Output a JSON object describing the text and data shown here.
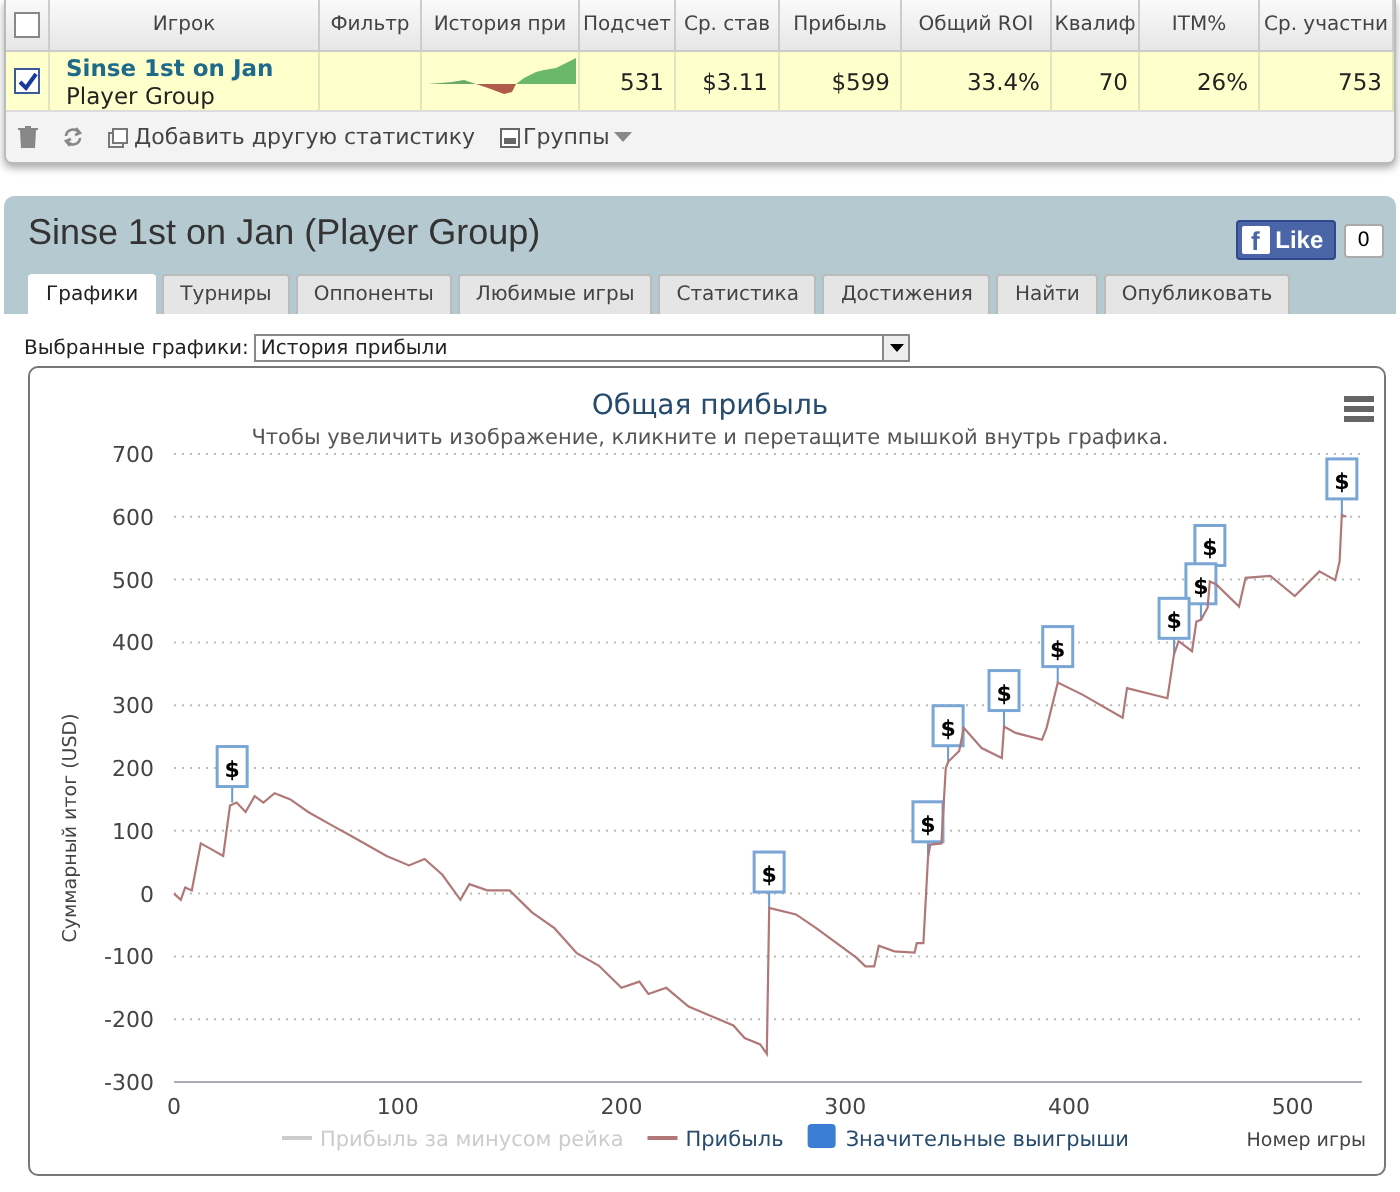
{
  "table": {
    "header_checked": false,
    "columns": [
      "Игрок",
      "Фильтр",
      "История при",
      "Подсчет",
      "Ср. став",
      "Прибыль",
      "Общий ROI",
      "Квалиф",
      "ITM%",
      "Ср. участни"
    ],
    "rows": [
      {
        "checked": true,
        "cells": [
          {
            "kind": "player",
            "name": "Sinse 1st on Jan",
            "type": "Player Group"
          },
          {
            "kind": "empty"
          },
          {
            "kind": "sparkline"
          },
          {
            "kind": "text",
            "text": "531"
          },
          {
            "kind": "text",
            "text": "$3.11"
          },
          {
            "kind": "text",
            "text": "$599"
          },
          {
            "kind": "text",
            "text": "33.4%"
          },
          {
            "kind": "text",
            "text": "70"
          },
          {
            "kind": "text",
            "text": "26%"
          },
          {
            "kind": "text",
            "text": "753"
          }
        ]
      }
    ],
    "toolbar": [
      {
        "kind": "delete"
      },
      {
        "kind": "refresh"
      },
      {
        "kind": "add",
        "label": "Добавить другую статистику"
      },
      {
        "kind": "groups",
        "label": "Группы"
      }
    ]
  },
  "group": {
    "title": "Sinse 1st on Jan (Player Group)",
    "like": {
      "icon": "f",
      "label": "Like",
      "count": "0"
    },
    "tabs": [
      {
        "label": "Графики",
        "selected": true
      },
      {
        "label": "Турниры",
        "selected": false
      },
      {
        "label": "Оппоненты",
        "selected": false
      },
      {
        "label": "Любимые игры",
        "selected": false
      },
      {
        "label": "Статистика",
        "selected": false
      },
      {
        "label": "Достижения",
        "selected": false
      },
      {
        "label": "Найти",
        "selected": false
      },
      {
        "label": "Опубликовать",
        "selected": false
      }
    ],
    "selector": {
      "label": "Выбранные графики:",
      "value": "История прибыли"
    },
    "chart": {
      "subtitle": "Чтобы увеличить изображение, кликните и перетащите мышкой внутрь графика.",
      "legend": [
        {
          "label": "Прибыль за минусом рейка",
          "kind": "line",
          "enabled": false,
          "color": "#cccccc"
        },
        {
          "kind": "series",
          "enabled": true
        },
        {
          "label": "Значительные выигрыши",
          "kind": "flag",
          "enabled": true,
          "color": "#3a7fd5"
        }
      ],
      "chart_data": {
        "type": "line",
        "title": "Общая прибыль",
        "xlabel": "Номер игры",
        "ylabel": "Суммарный итог (USD)",
        "grid": true,
        "x": [
          0,
          3,
          5,
          8,
          12,
          17,
          22,
          25,
          28,
          32,
          36,
          40,
          45,
          52,
          60,
          70,
          80,
          95,
          105,
          112,
          120,
          128,
          132,
          140,
          150,
          160,
          170,
          180,
          190,
          200,
          208,
          212,
          220,
          230,
          240,
          250,
          255,
          262,
          265,
          266,
          278,
          287,
          305,
          309,
          313,
          315,
          322,
          331,
          332,
          335,
          337,
          338,
          343,
          345,
          346,
          351,
          353,
          361,
          370,
          371,
          376,
          388,
          390,
          395,
          406,
          424,
          426,
          444,
          447,
          449,
          455,
          457,
          459,
          462,
          463,
          466,
          476,
          479,
          490,
          501,
          512,
          519,
          521,
          522,
          524
        ],
        "series": [
          {
            "name": "Прибыль",
            "color": "#b07878",
            "values": [
              0,
              -10,
              10,
              5,
              80,
              70,
              60,
              140,
              145,
              130,
              155,
              145,
              160,
              150,
              130,
              110,
              90,
              60,
              45,
              55,
              30,
              -10,
              15,
              5,
              5,
              -30,
              -55,
              -95,
              -115,
              -150,
              -140,
              -160,
              -150,
              -180,
              -195,
              -210,
              -230,
              -240,
              -255,
              -23,
              -33,
              -55,
              -102,
              -116,
              -116,
              -83,
              -92,
              -94,
              -79,
              -79,
              57,
              78,
              80,
              200,
              210,
              227,
              264,
              232,
              216,
              266,
              256,
              245,
              264,
              336,
              317,
              280,
              327,
              311,
              381,
              402,
              386,
              433,
              436,
              455,
              497,
              492,
              457,
              503,
              506,
              474,
              513,
              499,
              529,
              603,
              600
            ]
          }
        ],
        "xlim": [
          0,
          531
        ],
        "ylim": [
          -300,
          700
        ],
        "xticks": [
          0,
          100,
          200,
          300,
          400,
          500
        ],
        "yticks": [
          -300,
          -200,
          -100,
          0,
          100,
          200,
          300,
          400,
          500,
          600,
          700
        ],
        "annotations": [
          {
            "x": 26,
            "y": 145,
            "text": "$"
          },
          {
            "x": 266,
            "y": -23,
            "text": "$"
          },
          {
            "x": 337,
            "y": 57,
            "text": "$"
          },
          {
            "x": 346,
            "y": 210,
            "text": "$"
          },
          {
            "x": 371,
            "y": 266,
            "text": "$"
          },
          {
            "x": 395,
            "y": 336,
            "text": "$"
          },
          {
            "x": 447,
            "y": 381,
            "text": "$"
          },
          {
            "x": 459,
            "y": 436,
            "text": "$"
          },
          {
            "x": 463,
            "y": 497,
            "text": "$"
          },
          {
            "x": 522,
            "y": 603,
            "text": "$"
          }
        ]
      }
    }
  }
}
